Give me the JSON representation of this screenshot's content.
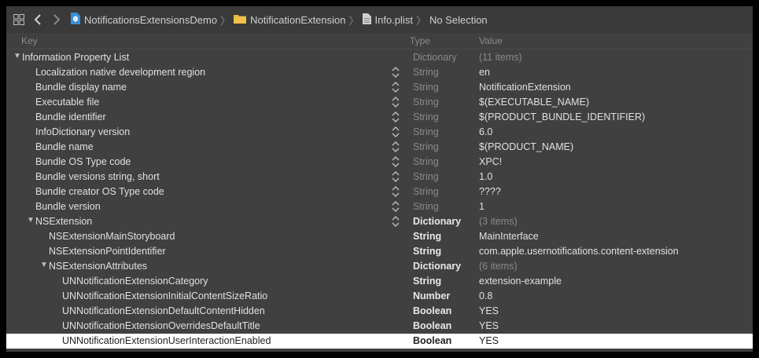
{
  "breadcrumb": {
    "project": "NotificationsExtensionsDemo",
    "folder": "NotificationExtension",
    "file": "Info.plist",
    "selection": "No Selection"
  },
  "header": {
    "key": "Key",
    "type": "Type",
    "value": "Value"
  },
  "rows": [
    {
      "key": "Information Property List",
      "type": "Dictionary",
      "value": "(11 items)",
      "level": 0,
      "disclosure": true,
      "stepper": false,
      "bold_type": false,
      "dim_value": true
    },
    {
      "key": "Localization native development region",
      "type": "String",
      "value": "en",
      "level": 1,
      "disclosure": false,
      "stepper": true,
      "bold_type": false,
      "dim_value": false
    },
    {
      "key": "Bundle display name",
      "type": "String",
      "value": "NotificationExtension",
      "level": 1,
      "disclosure": false,
      "stepper": true,
      "bold_type": false,
      "dim_value": false
    },
    {
      "key": "Executable file",
      "type": "String",
      "value": "$(EXECUTABLE_NAME)",
      "level": 1,
      "disclosure": false,
      "stepper": true,
      "bold_type": false,
      "dim_value": false
    },
    {
      "key": "Bundle identifier",
      "type": "String",
      "value": "$(PRODUCT_BUNDLE_IDENTIFIER)",
      "level": 1,
      "disclosure": false,
      "stepper": true,
      "bold_type": false,
      "dim_value": false
    },
    {
      "key": "InfoDictionary version",
      "type": "String",
      "value": "6.0",
      "level": 1,
      "disclosure": false,
      "stepper": true,
      "bold_type": false,
      "dim_value": false
    },
    {
      "key": "Bundle name",
      "type": "String",
      "value": "$(PRODUCT_NAME)",
      "level": 1,
      "disclosure": false,
      "stepper": true,
      "bold_type": false,
      "dim_value": false
    },
    {
      "key": "Bundle OS Type code",
      "type": "String",
      "value": "XPC!",
      "level": 1,
      "disclosure": false,
      "stepper": true,
      "bold_type": false,
      "dim_value": false
    },
    {
      "key": "Bundle versions string, short",
      "type": "String",
      "value": "1.0",
      "level": 1,
      "disclosure": false,
      "stepper": true,
      "bold_type": false,
      "dim_value": false
    },
    {
      "key": "Bundle creator OS Type code",
      "type": "String",
      "value": "????",
      "level": 1,
      "disclosure": false,
      "stepper": true,
      "bold_type": false,
      "dim_value": false
    },
    {
      "key": "Bundle version",
      "type": "String",
      "value": "1",
      "level": 1,
      "disclosure": false,
      "stepper": true,
      "bold_type": false,
      "dim_value": false
    },
    {
      "key": "NSExtension",
      "type": "Dictionary",
      "value": "(3 items)",
      "level": 1,
      "disclosure": true,
      "stepper": true,
      "bold_type": true,
      "dim_value": true
    },
    {
      "key": "NSExtensionMainStoryboard",
      "type": "String",
      "value": "MainInterface",
      "level": 2,
      "disclosure": false,
      "stepper": false,
      "bold_type": true,
      "dim_value": false
    },
    {
      "key": "NSExtensionPointIdentifier",
      "type": "String",
      "value": "com.apple.usernotifications.content-extension",
      "level": 2,
      "disclosure": false,
      "stepper": false,
      "bold_type": true,
      "dim_value": false
    },
    {
      "key": "NSExtensionAttributes",
      "type": "Dictionary",
      "value": "(6 items)",
      "level": 2,
      "disclosure": true,
      "stepper": false,
      "bold_type": true,
      "dim_value": true
    },
    {
      "key": "UNNotificationExtensionCategory",
      "type": "String",
      "value": "extension-example",
      "level": 3,
      "disclosure": false,
      "stepper": false,
      "bold_type": true,
      "dim_value": false
    },
    {
      "key": "UNNotificationExtensionInitialContentSizeRatio",
      "type": "Number",
      "value": "0.8",
      "level": 3,
      "disclosure": false,
      "stepper": false,
      "bold_type": true,
      "dim_value": false
    },
    {
      "key": "UNNotificationExtensionDefaultContentHidden",
      "type": "Boolean",
      "value": "YES",
      "level": 3,
      "disclosure": false,
      "stepper": false,
      "bold_type": true,
      "dim_value": false
    },
    {
      "key": "UNNotificationExtensionOverridesDefaultTitle",
      "type": "Boolean",
      "value": "YES",
      "level": 3,
      "disclosure": false,
      "stepper": false,
      "bold_type": true,
      "dim_value": false
    },
    {
      "key": "UNNotificationExtensionUserInteractionEnabled",
      "type": "Boolean",
      "value": "YES",
      "level": 3,
      "disclosure": false,
      "stepper": false,
      "bold_type": true,
      "dim_value": false,
      "selected": true
    }
  ]
}
